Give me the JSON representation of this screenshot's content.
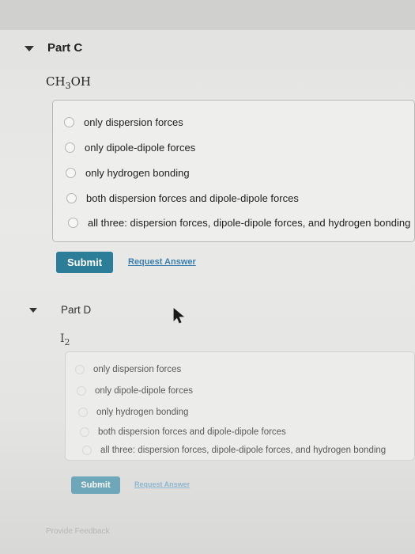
{
  "part_c": {
    "title": "Part C",
    "formula": {
      "main": "CH",
      "sub": "3",
      "tail": "OH"
    },
    "options": [
      "only dispersion forces",
      "only dipole-dipole forces",
      "only hydrogen bonding",
      "both dispersion forces and dipole-dipole forces",
      "all three: dispersion forces, dipole-dipole forces, and hydrogen bonding"
    ],
    "submit_label": "Submit",
    "request_label": "Request Answer"
  },
  "part_d": {
    "title": "Part D",
    "formula": {
      "main": "I",
      "sub": "2"
    },
    "options": [
      "only dispersion forces",
      "only dipole-dipole forces",
      "only hydrogen bonding",
      "both dispersion forces and dipole-dipole forces",
      "all three: dispersion forces, dipole-dipole forces, and hydrogen bonding"
    ],
    "submit_label": "Submit",
    "request_label": "Request Answer"
  },
  "footer": {
    "feedback_label": "Provide Feedback"
  },
  "colors": {
    "submit_bg": "#2c7d98",
    "link": "#3a7fb0"
  }
}
